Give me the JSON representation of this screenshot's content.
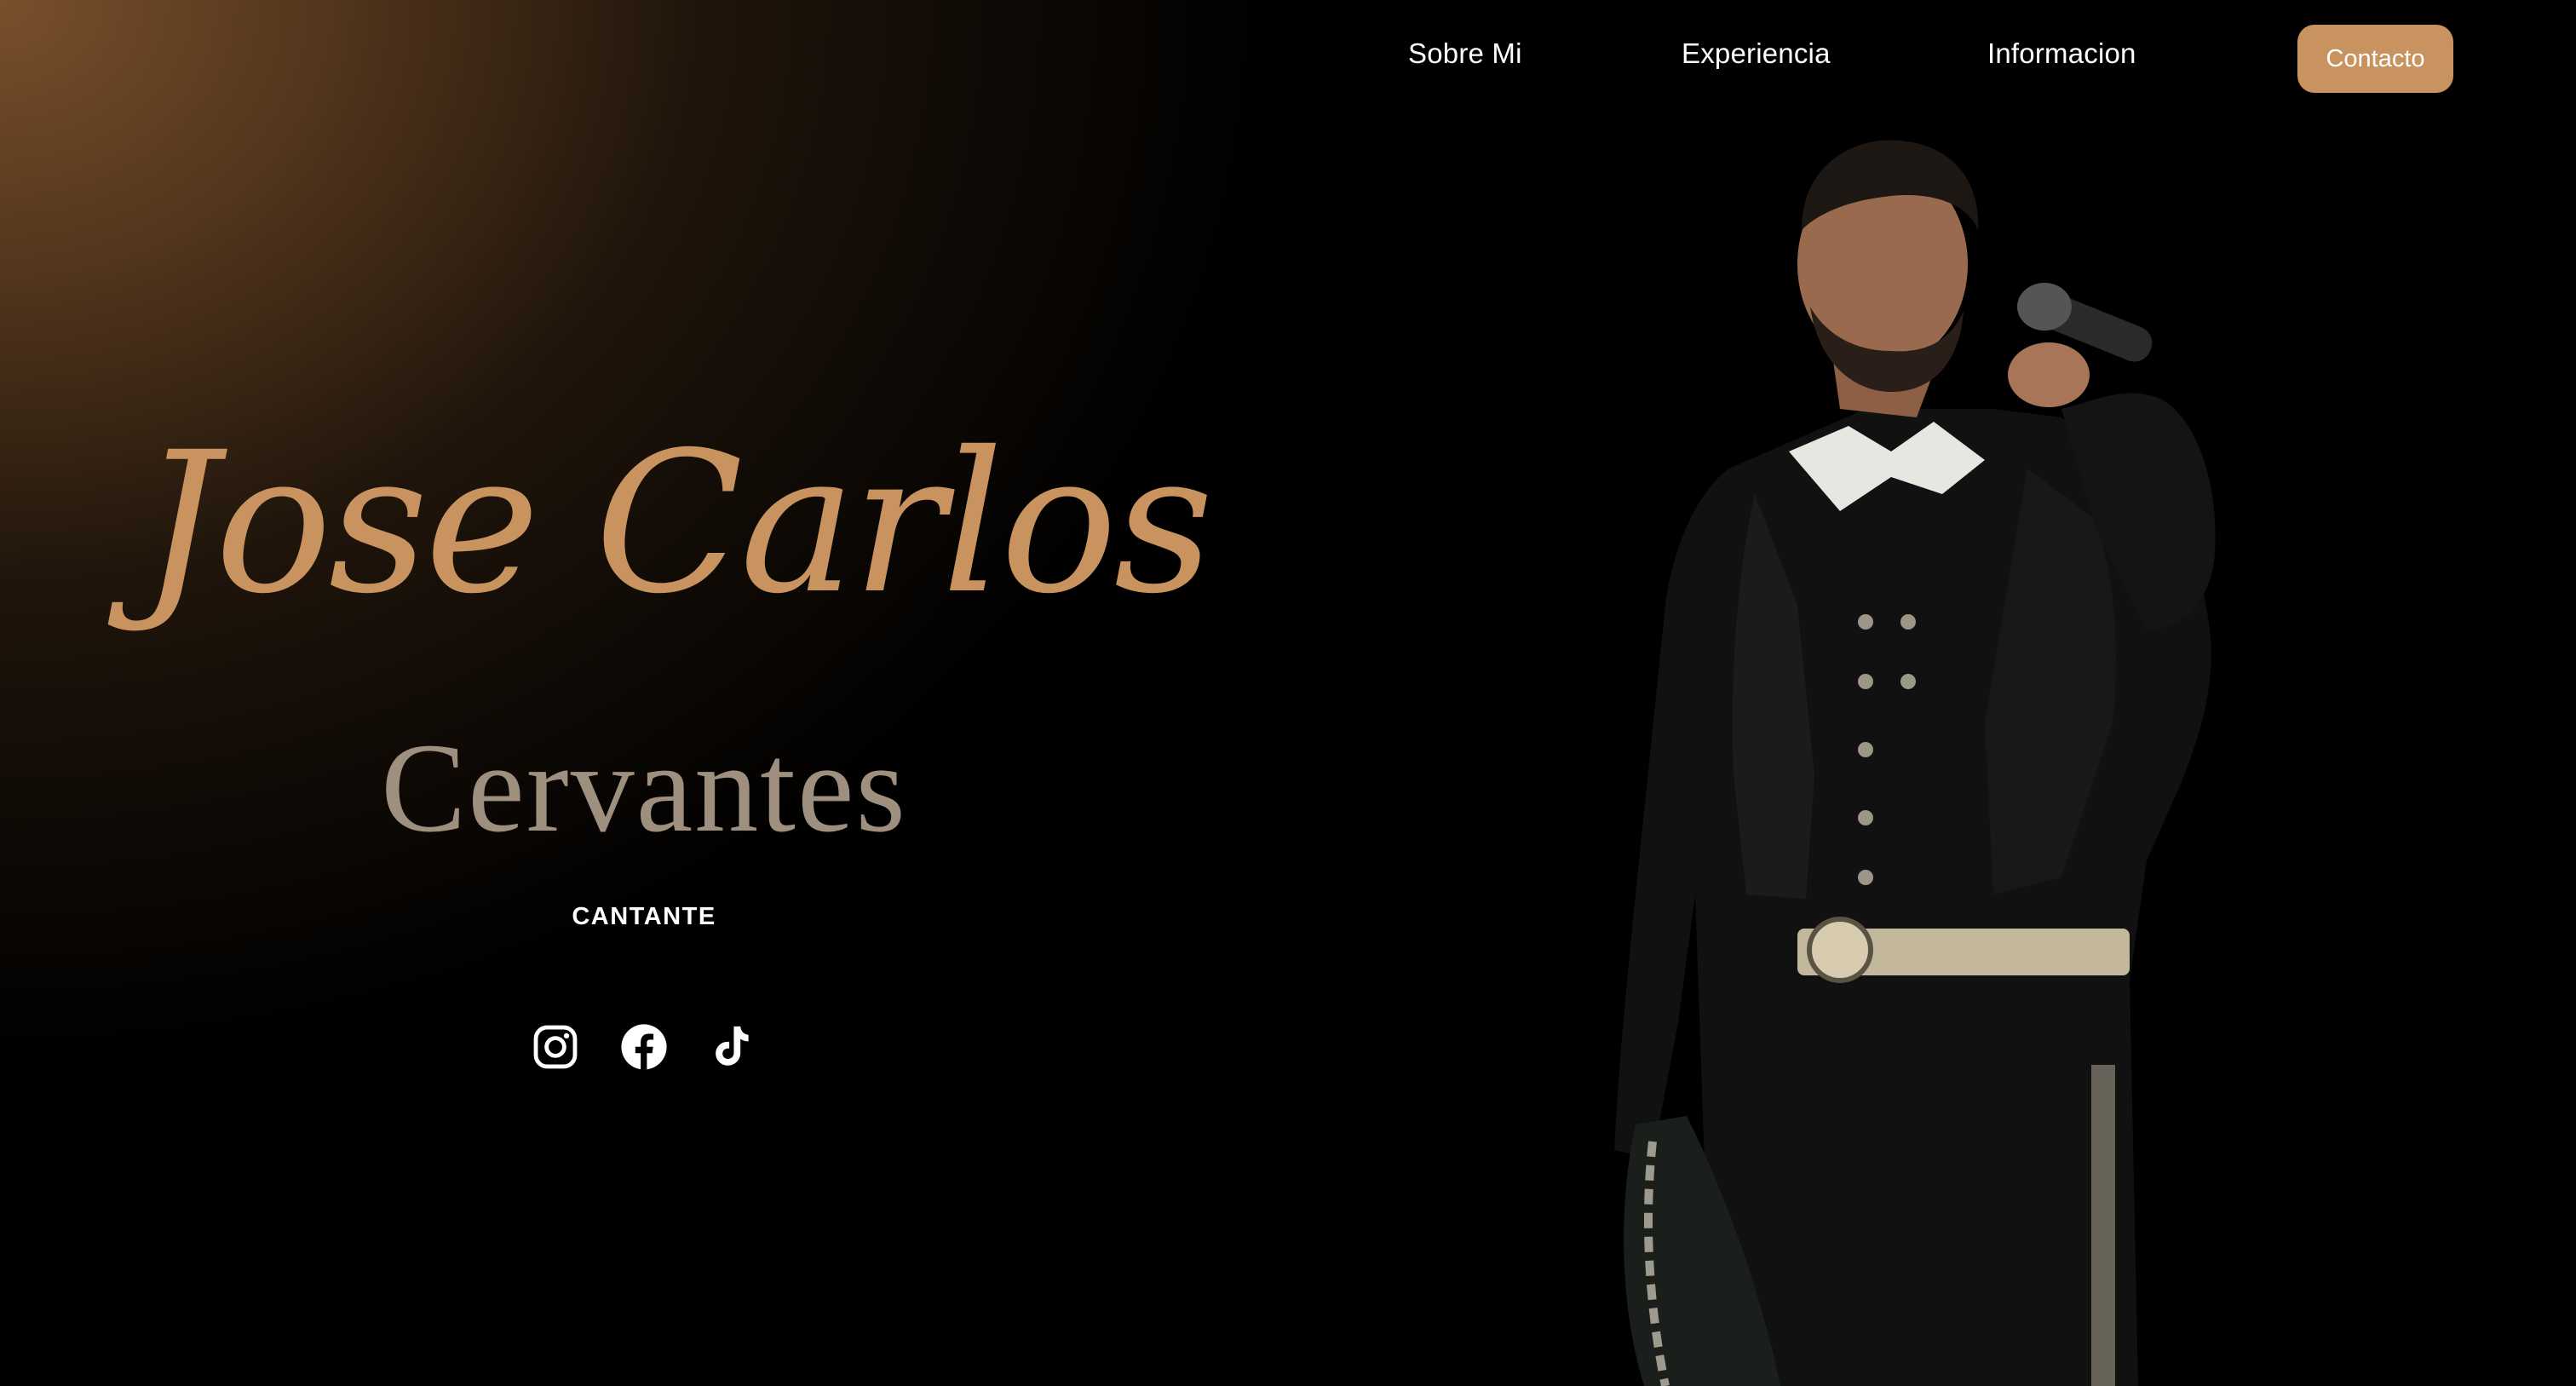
{
  "nav": {
    "links": [
      "Sobre Mi",
      "Experiencia",
      "Informacion"
    ],
    "contact_label": "Contacto"
  },
  "hero": {
    "first_name": "Jose Carlos",
    "last_name": "Cervantes",
    "role": "CANTANTE",
    "socials": [
      "instagram-icon",
      "facebook-icon",
      "tiktok-icon"
    ]
  },
  "colors": {
    "accent": "#c8935f",
    "last_name": "#9e8f7e",
    "background": "#000000",
    "gradient": "#80542e"
  }
}
